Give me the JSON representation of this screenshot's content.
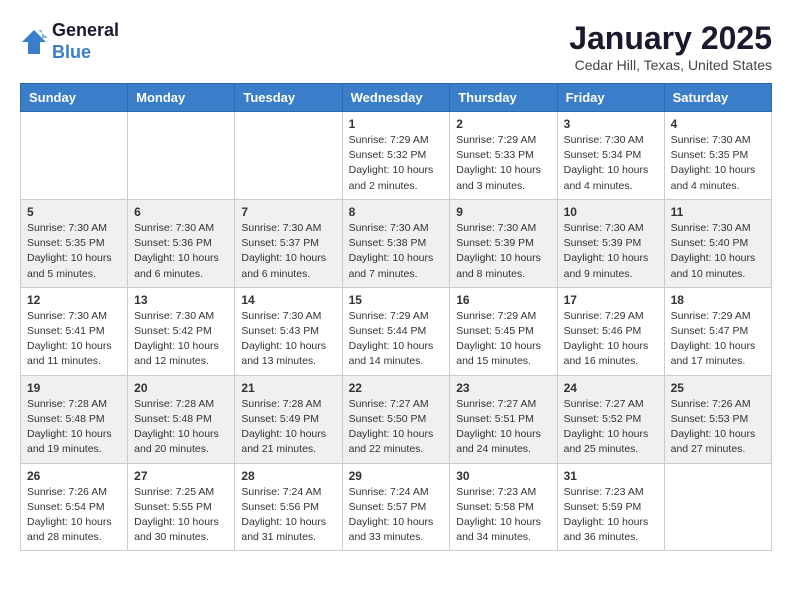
{
  "header": {
    "logo_line1": "General",
    "logo_line2": "Blue",
    "month_title": "January 2025",
    "location": "Cedar Hill, Texas, United States"
  },
  "weekdays": [
    "Sunday",
    "Monday",
    "Tuesday",
    "Wednesday",
    "Thursday",
    "Friday",
    "Saturday"
  ],
  "weeks": [
    [
      {
        "day": "",
        "info": ""
      },
      {
        "day": "",
        "info": ""
      },
      {
        "day": "",
        "info": ""
      },
      {
        "day": "1",
        "info": "Sunrise: 7:29 AM\nSunset: 5:32 PM\nDaylight: 10 hours\nand 2 minutes."
      },
      {
        "day": "2",
        "info": "Sunrise: 7:29 AM\nSunset: 5:33 PM\nDaylight: 10 hours\nand 3 minutes."
      },
      {
        "day": "3",
        "info": "Sunrise: 7:30 AM\nSunset: 5:34 PM\nDaylight: 10 hours\nand 4 minutes."
      },
      {
        "day": "4",
        "info": "Sunrise: 7:30 AM\nSunset: 5:35 PM\nDaylight: 10 hours\nand 4 minutes."
      }
    ],
    [
      {
        "day": "5",
        "info": "Sunrise: 7:30 AM\nSunset: 5:35 PM\nDaylight: 10 hours\nand 5 minutes."
      },
      {
        "day": "6",
        "info": "Sunrise: 7:30 AM\nSunset: 5:36 PM\nDaylight: 10 hours\nand 6 minutes."
      },
      {
        "day": "7",
        "info": "Sunrise: 7:30 AM\nSunset: 5:37 PM\nDaylight: 10 hours\nand 6 minutes."
      },
      {
        "day": "8",
        "info": "Sunrise: 7:30 AM\nSunset: 5:38 PM\nDaylight: 10 hours\nand 7 minutes."
      },
      {
        "day": "9",
        "info": "Sunrise: 7:30 AM\nSunset: 5:39 PM\nDaylight: 10 hours\nand 8 minutes."
      },
      {
        "day": "10",
        "info": "Sunrise: 7:30 AM\nSunset: 5:39 PM\nDaylight: 10 hours\nand 9 minutes."
      },
      {
        "day": "11",
        "info": "Sunrise: 7:30 AM\nSunset: 5:40 PM\nDaylight: 10 hours\nand 10 minutes."
      }
    ],
    [
      {
        "day": "12",
        "info": "Sunrise: 7:30 AM\nSunset: 5:41 PM\nDaylight: 10 hours\nand 11 minutes."
      },
      {
        "day": "13",
        "info": "Sunrise: 7:30 AM\nSunset: 5:42 PM\nDaylight: 10 hours\nand 12 minutes."
      },
      {
        "day": "14",
        "info": "Sunrise: 7:30 AM\nSunset: 5:43 PM\nDaylight: 10 hours\nand 13 minutes."
      },
      {
        "day": "15",
        "info": "Sunrise: 7:29 AM\nSunset: 5:44 PM\nDaylight: 10 hours\nand 14 minutes."
      },
      {
        "day": "16",
        "info": "Sunrise: 7:29 AM\nSunset: 5:45 PM\nDaylight: 10 hours\nand 15 minutes."
      },
      {
        "day": "17",
        "info": "Sunrise: 7:29 AM\nSunset: 5:46 PM\nDaylight: 10 hours\nand 16 minutes."
      },
      {
        "day": "18",
        "info": "Sunrise: 7:29 AM\nSunset: 5:47 PM\nDaylight: 10 hours\nand 17 minutes."
      }
    ],
    [
      {
        "day": "19",
        "info": "Sunrise: 7:28 AM\nSunset: 5:48 PM\nDaylight: 10 hours\nand 19 minutes."
      },
      {
        "day": "20",
        "info": "Sunrise: 7:28 AM\nSunset: 5:48 PM\nDaylight: 10 hours\nand 20 minutes."
      },
      {
        "day": "21",
        "info": "Sunrise: 7:28 AM\nSunset: 5:49 PM\nDaylight: 10 hours\nand 21 minutes."
      },
      {
        "day": "22",
        "info": "Sunrise: 7:27 AM\nSunset: 5:50 PM\nDaylight: 10 hours\nand 22 minutes."
      },
      {
        "day": "23",
        "info": "Sunrise: 7:27 AM\nSunset: 5:51 PM\nDaylight: 10 hours\nand 24 minutes."
      },
      {
        "day": "24",
        "info": "Sunrise: 7:27 AM\nSunset: 5:52 PM\nDaylight: 10 hours\nand 25 minutes."
      },
      {
        "day": "25",
        "info": "Sunrise: 7:26 AM\nSunset: 5:53 PM\nDaylight: 10 hours\nand 27 minutes."
      }
    ],
    [
      {
        "day": "26",
        "info": "Sunrise: 7:26 AM\nSunset: 5:54 PM\nDaylight: 10 hours\nand 28 minutes."
      },
      {
        "day": "27",
        "info": "Sunrise: 7:25 AM\nSunset: 5:55 PM\nDaylight: 10 hours\nand 30 minutes."
      },
      {
        "day": "28",
        "info": "Sunrise: 7:24 AM\nSunset: 5:56 PM\nDaylight: 10 hours\nand 31 minutes."
      },
      {
        "day": "29",
        "info": "Sunrise: 7:24 AM\nSunset: 5:57 PM\nDaylight: 10 hours\nand 33 minutes."
      },
      {
        "day": "30",
        "info": "Sunrise: 7:23 AM\nSunset: 5:58 PM\nDaylight: 10 hours\nand 34 minutes."
      },
      {
        "day": "31",
        "info": "Sunrise: 7:23 AM\nSunset: 5:59 PM\nDaylight: 10 hours\nand 36 minutes."
      },
      {
        "day": "",
        "info": ""
      }
    ]
  ]
}
